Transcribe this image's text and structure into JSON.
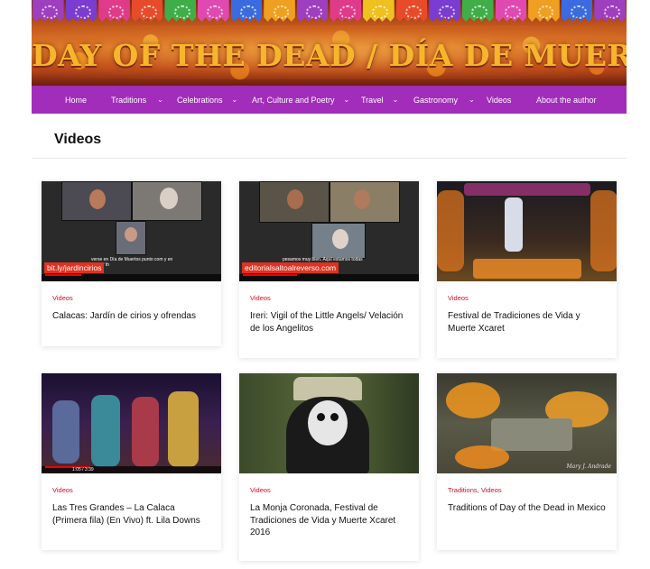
{
  "banner": {
    "title": "DAY OF THE DEAD / DÍA DE MUERTOS",
    "flag_colors": [
      "#9e3fbf",
      "#7a3cd1",
      "#e03b8b",
      "#e84b2a",
      "#3fae49",
      "#e04ab0",
      "#3a6be0",
      "#f0a020",
      "#9e3fbf",
      "#e03b8b",
      "#f0c020",
      "#e84b2a",
      "#7a3cd1",
      "#3fae49",
      "#e04ab0",
      "#f0a020",
      "#3a6be0",
      "#9e3fbf"
    ]
  },
  "nav": {
    "items": [
      {
        "label": "Home",
        "dropdown": false
      },
      {
        "label": "Traditions",
        "dropdown": true
      },
      {
        "label": "Celebrations",
        "dropdown": true
      },
      {
        "label": "Art, Culture and Poetry",
        "dropdown": true
      },
      {
        "label": "Travel",
        "dropdown": true
      },
      {
        "label": "Gastronomy",
        "dropdown": true
      },
      {
        "label": "Videos",
        "dropdown": false
      },
      {
        "label": "About the author",
        "dropdown": false
      }
    ],
    "chevron": "⌄"
  },
  "page": {
    "title": "Videos"
  },
  "cards": [
    {
      "categories": [
        "Videos"
      ],
      "title": "Calacas: Jardín de cirios y ofrendas",
      "thumb_url": "bit.ly/jardincirios",
      "thumb_caption": "verse en Día de Muertos punto com y en Day of th"
    },
    {
      "categories": [
        "Videos"
      ],
      "title": "Ireri: Vigil of the Little Angels/ Velación de los Angelitos",
      "thumb_url": "editorialsaltoalreverso.com",
      "thumb_caption": "pesamos muy bien. Aquí estamos todas"
    },
    {
      "categories": [
        "Videos"
      ],
      "title": "Festival de Tradiciones de Vida y Muerte Xcaret",
      "thumb_watermark": ""
    },
    {
      "categories": [
        "Videos"
      ],
      "title": "Las Tres Grandes – La Calaca (Primera fila) (En Vivo) ft. Lila Downs",
      "thumb_time": "1:05 / 3:39"
    },
    {
      "categories": [
        "Videos"
      ],
      "title": "La Monja Coronada, Festival de Tradiciones de Vida y Muerte Xcaret 2016"
    },
    {
      "categories": [
        "Traditions",
        "Videos"
      ],
      "category_separator": ", ",
      "title": "Traditions of Day of the Dead in Mexico",
      "thumb_watermark": "Mary J. Andrade"
    }
  ],
  "colors": {
    "nav": "#a22dbb",
    "category": "#c8102e",
    "banner_text": "#f7b52c"
  }
}
